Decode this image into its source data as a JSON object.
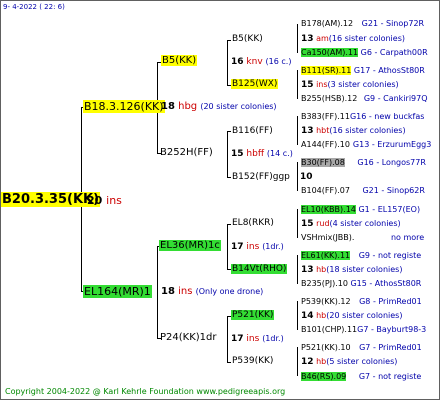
{
  "date": "9-  4-2022 ( 22:  6)",
  "copyright": "Copyright 2004-2022 @ Karl Kehrle Foundation   www.pedigreeapis.org",
  "root": {
    "label": "B20.3.35(KK)",
    "num": "20",
    "suffix": "ins"
  },
  "g1_top": {
    "label": "B18.3.126(KK)",
    "num": "18",
    "suffix": "hbg",
    "note": "(20 sister colonies)"
  },
  "g1_bot": {
    "label": "EL164(MR)1",
    "num": "18",
    "suffix": "ins",
    "note": "(Only one drone)"
  },
  "g2_a": {
    "label": "B5(KK)",
    "num": "16",
    "suffix": "knv",
    "note": "(16 c.)"
  },
  "g2_b": {
    "label": "B252H(FF)",
    "num": "15",
    "suffix": "hbff",
    "note": "(14 c.)"
  },
  "g2_c": {
    "label": "EL36(MR)1c",
    "num": "17",
    "suffix": "ins",
    "note": "(1dr.)"
  },
  "g2_d": {
    "label": "P24(KK)1dr",
    "num": "17",
    "suffix": "ins",
    "note": "(1dr.)"
  },
  "g3": [
    {
      "label": "B5(KK)"
    },
    {
      "label": "B125(WX)"
    },
    {
      "label": "B116(FF)"
    },
    {
      "label": "B152(FF)ggp",
      "num": "10"
    },
    {
      "label": "EL8(RKR)"
    },
    {
      "label": "B14Vt(RHO)"
    },
    {
      "label": "P521(KK)"
    },
    {
      "label": "P539(KK)"
    }
  ],
  "g4": [
    {
      "id": "B178(AM).12",
      "src": "G21 - Sinop72R"
    },
    {
      "num": "13",
      "sfx": "am",
      "note": "(16 sister colonies)"
    },
    {
      "id": "Ca150(AM).11",
      "src": "G6 - Carpath00R"
    },
    {
      "id": "B111(SR).11",
      "src": "G17 - AthosSt80R"
    },
    {
      "num": "15",
      "sfx": "ins",
      "note": "(3 sister colonies)"
    },
    {
      "id": "B255(HSB).12",
      "src": "G9 - Cankiri97Q"
    },
    {
      "id": "B383(FF).11",
      "src": "G16 - new buckfas"
    },
    {
      "num": "13",
      "sfx": "hbt",
      "note": "(16 sister colonies)"
    },
    {
      "id": "A144(FF).10",
      "src": "G13 - ErzurumEgg3"
    },
    {
      "id": "B30(FF).08",
      "src": "G16 - Longos77R"
    },
    {
      "id": "B104(FF).07",
      "src": "G21 - Sinop62R"
    },
    {
      "id": "EL10(KBB).14",
      "src": "G1 - EL157(EO)"
    },
    {
      "num": "15",
      "sfx": "rud",
      "note": "(4 sister colonies)"
    },
    {
      "id": "VSHmix(JBB).",
      "src": "no more"
    },
    {
      "id": "EL61(KK).11",
      "src": "G9 - not registe"
    },
    {
      "num": "13",
      "sfx": "hb",
      "note": "(18 sister colonies)"
    },
    {
      "id": "B235(PJ).10",
      "src": "G15 - AthosSt80R"
    },
    {
      "id": "P539(KK).12",
      "src": "G8 - PrimRed01"
    },
    {
      "num": "14",
      "sfx": "hb",
      "note": "(20 sister colonies)"
    },
    {
      "id": "B101(CHP).11",
      "src": "G7 - Bayburt98-3"
    },
    {
      "id": "P521(KK).10",
      "src": "G7 - PrimRed01"
    },
    {
      "num": "12",
      "sfx": "hb",
      "note": "(5 sister colonies)"
    },
    {
      "id": "B46(RS).09",
      "src": "G7 - not registe"
    }
  ]
}
